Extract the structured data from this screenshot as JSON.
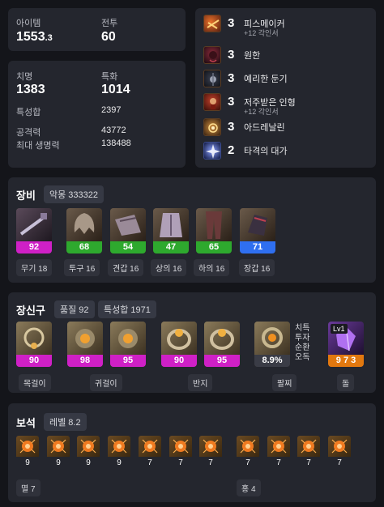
{
  "stats": {
    "item_level_label": "아이템",
    "item_level_main": "1553",
    "item_level_dec": ".3",
    "combat_label": "전투",
    "combat_value": "60",
    "crit_label": "치명",
    "crit_value": "1383",
    "spec_label": "특화",
    "spec_value": "1014",
    "total_stat_label": "특성합",
    "total_stat_value": "2397",
    "attack_label": "공격력",
    "attack_value": "43772",
    "hp_label": "최대 생명력",
    "hp_value": "138488"
  },
  "engravings": [
    {
      "level": "3",
      "name": "피스메이커",
      "sub": "+12 각인서",
      "icon": "peacemaker-icon"
    },
    {
      "level": "3",
      "name": "원한",
      "sub": "",
      "icon": "grudge-icon"
    },
    {
      "level": "3",
      "name": "예리한 둔기",
      "sub": "",
      "icon": "keen-blunt-icon"
    },
    {
      "level": "3",
      "name": "저주받은 인형",
      "sub": "+12 각인서",
      "icon": "cursed-doll-icon"
    },
    {
      "level": "3",
      "name": "아드레날린",
      "sub": "",
      "icon": "adrenaline-icon"
    },
    {
      "level": "2",
      "name": "타격의 대가",
      "sub": "",
      "icon": "hit-master-icon"
    }
  ],
  "equipment": {
    "title": "장비",
    "badge": "악몽 333322",
    "items": [
      {
        "quality": "92",
        "caption": "무기 18",
        "icon": "weapon-icon",
        "color": "#cf20c6"
      },
      {
        "quality": "68",
        "caption": "투구 16",
        "icon": "helmet-icon",
        "color": "#2ea92e"
      },
      {
        "quality": "54",
        "caption": "견갑 16",
        "icon": "shoulder-icon",
        "color": "#2ea92e"
      },
      {
        "quality": "47",
        "caption": "상의 16",
        "icon": "chest-icon",
        "color": "#2ea92e"
      },
      {
        "quality": "65",
        "caption": "하의 16",
        "icon": "pants-icon",
        "color": "#2ea92e"
      },
      {
        "quality": "71",
        "caption": "장갑 16",
        "icon": "gloves-icon",
        "color": "#2f6ff0"
      }
    ]
  },
  "accessories": {
    "title": "장신구",
    "quality_badge": "품질 92",
    "stat_badge": "특성합 1971",
    "items": [
      {
        "quality": "90",
        "icon": "necklace-icon",
        "color": "#cf20c6"
      },
      {
        "quality": "98",
        "icon": "earring-icon",
        "color": "#cf20c6"
      },
      {
        "quality": "95",
        "icon": "earring-icon",
        "color": "#cf20c6"
      },
      {
        "quality": "90",
        "icon": "ring-icon",
        "color": "#cf20c6"
      },
      {
        "quality": "95",
        "icon": "ring-icon",
        "color": "#cf20c6"
      }
    ],
    "bracelet": {
      "value": "8.9%",
      "icon": "bracelet-icon",
      "color": "#3a3c46",
      "options": [
        "치특",
        "투자",
        "순환",
        "오독"
      ]
    },
    "stone": {
      "value": "9 7 3",
      "level": "Lv1",
      "icon": "ability-stone-icon",
      "color": "#e2780f"
    },
    "captions": {
      "necklace": "목걸이",
      "earring": "귀걸이",
      "ring": "반지",
      "bracelet": "팔찌",
      "stone": "돌"
    }
  },
  "gems": {
    "title": "보석",
    "badge": "레벨 8.2",
    "levels": [
      "9",
      "9",
      "9",
      "9",
      "7",
      "7",
      "7",
      "7",
      "7",
      "7",
      "7"
    ],
    "caption_left": "멸 7",
    "caption_right": "홍 4"
  }
}
